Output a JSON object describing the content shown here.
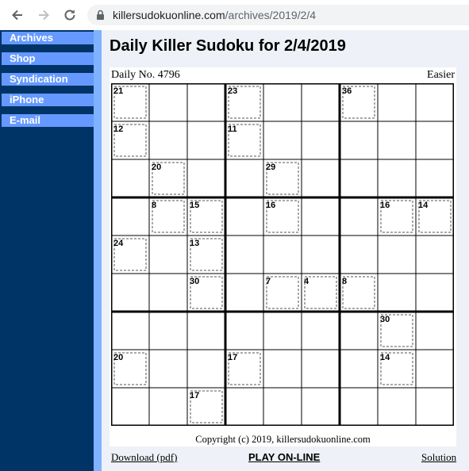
{
  "browser": {
    "url_host": "killersudokuonline.com",
    "url_path": "/archives/2019/2/4"
  },
  "sidebar": {
    "items": [
      {
        "label": "Archives"
      },
      {
        "label": "Shop"
      },
      {
        "label": "Syndication"
      },
      {
        "label": "iPhone"
      },
      {
        "label": "E-mail"
      }
    ]
  },
  "page": {
    "title": "Daily Killer Sudoku for 2/4/2019",
    "daily_no": "Daily No. 4796",
    "difficulty": "Easier",
    "copyright": "Copyright (c) 2019, killersudokuonline.com"
  },
  "puzzle": {
    "cage_sums": [
      {
        "row": 0,
        "col": 0,
        "label": "21"
      },
      {
        "row": 0,
        "col": 3,
        "label": "23"
      },
      {
        "row": 0,
        "col": 6,
        "label": "36"
      },
      {
        "row": 1,
        "col": 0,
        "label": "12"
      },
      {
        "row": 1,
        "col": 3,
        "label": "11"
      },
      {
        "row": 2,
        "col": 1,
        "label": "20"
      },
      {
        "row": 2,
        "col": 4,
        "label": "29"
      },
      {
        "row": 3,
        "col": 1,
        "label": "8"
      },
      {
        "row": 3,
        "col": 2,
        "label": "15"
      },
      {
        "row": 3,
        "col": 4,
        "label": "16"
      },
      {
        "row": 3,
        "col": 7,
        "label": "16"
      },
      {
        "row": 3,
        "col": 8,
        "label": "14"
      },
      {
        "row": 4,
        "col": 0,
        "label": "24"
      },
      {
        "row": 4,
        "col": 2,
        "label": "13"
      },
      {
        "row": 5,
        "col": 2,
        "label": "30"
      },
      {
        "row": 5,
        "col": 4,
        "label": "7"
      },
      {
        "row": 5,
        "col": 5,
        "label": "4"
      },
      {
        "row": 5,
        "col": 6,
        "label": "8"
      },
      {
        "row": 6,
        "col": 7,
        "label": "30"
      },
      {
        "row": 7,
        "col": 0,
        "label": "20"
      },
      {
        "row": 7,
        "col": 3,
        "label": "17"
      },
      {
        "row": 7,
        "col": 7,
        "label": "14"
      },
      {
        "row": 8,
        "col": 2,
        "label": "17"
      }
    ]
  },
  "footer": {
    "download": "Download (pdf)",
    "play": "PLAY ON-LINE",
    "solution": "Solution"
  }
}
